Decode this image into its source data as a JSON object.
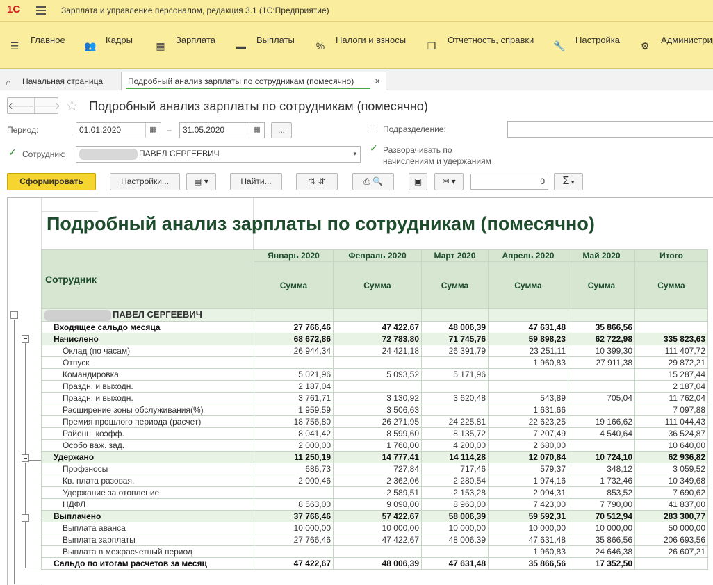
{
  "app": {
    "title": "Зарплата и управление персоналом, редакция 3.1  (1С:Предприятие)",
    "logo": "1С"
  },
  "sections": [
    {
      "label": "Главное",
      "icon": "menu-lines-icon"
    },
    {
      "label": "Кадры",
      "icon": "people-icon"
    },
    {
      "label": "Зарплата",
      "icon": "calculator-icon"
    },
    {
      "label": "Выплаты",
      "icon": "wallet-icon"
    },
    {
      "label": "Налоги и взносы",
      "icon": "percent-icon"
    },
    {
      "label": "Отчетность, справки",
      "icon": "documents-icon"
    },
    {
      "label": "Настройка",
      "icon": "wrench-icon"
    },
    {
      "label": "Администрир",
      "icon": "gear-icon"
    }
  ],
  "tabs": {
    "home": "Начальная страница",
    "active": "Подробный анализ зарплаты по сотрудникам (помесячно)"
  },
  "form": {
    "title": "Подробный анализ зарплаты по сотрудникам (помесячно)",
    "period_label": "Период:",
    "period_from": "01.01.2020",
    "period_dash": "–",
    "period_to": "31.05.2020",
    "dots": "...",
    "subdivision_label": "Подразделение:",
    "employee_label": "Сотрудник:",
    "employee_value": "ПАВЕЛ СЕРГЕЕВИЧ",
    "expand_label_1": "Разворачивать по",
    "expand_label_2": "начислениям и удержаниям",
    "btn_generate": "Сформировать",
    "btn_settings": "Настройки...",
    "btn_find": "Найти...",
    "sum_value": "0",
    "sum_icon": "Σ"
  },
  "report": {
    "title": "Подробный анализ зарплаты по сотрудникам (помесячно)",
    "employee_header": "Сотрудник",
    "months": [
      "Январь 2020",
      "Февраль 2020",
      "Март 2020",
      "Апрель 2020",
      "Май 2020",
      "Итого"
    ],
    "sum_label": "Сумма",
    "employee_name": "ПАВЕЛ СЕРГЕЕВИЧ",
    "rows": [
      {
        "label": "Входящее сальдо месяца",
        "vals": [
          "27 766,46",
          "47 422,67",
          "48 006,39",
          "47 631,48",
          "35 866,56",
          ""
        ]
      },
      {
        "label": "Начислено",
        "vals": [
          "68 672,86",
          "72 783,80",
          "71 745,76",
          "59 898,23",
          "62 722,98",
          "335 823,63"
        ]
      },
      {
        "label": "Оклад (по часам)",
        "vals": [
          "26 944,34",
          "24 421,18",
          "26 391,79",
          "23 251,11",
          "10 399,30",
          "111 407,72"
        ]
      },
      {
        "label": "Отпуск",
        "vals": [
          "",
          "",
          "",
          "1 960,83",
          "27 911,38",
          "29 872,21"
        ]
      },
      {
        "label": "Командировка",
        "vals": [
          "5 021,96",
          "5 093,52",
          "5 171,96",
          "",
          "",
          "15 287,44"
        ]
      },
      {
        "label": "Праздн. и выходн.",
        "vals": [
          "2 187,04",
          "",
          "",
          "",
          "",
          "2 187,04"
        ]
      },
      {
        "label": "Праздн. и выходн.",
        "vals": [
          "3 761,71",
          "3 130,92",
          "3 620,48",
          "543,89",
          "705,04",
          "11 762,04"
        ]
      },
      {
        "label": "Расширение зоны обслуживания(%)",
        "vals": [
          "1 959,59",
          "3 506,63",
          "",
          "1 631,66",
          "",
          "7 097,88"
        ]
      },
      {
        "label": "Премия прошлого периода (расчет)",
        "vals": [
          "18 756,80",
          "26 271,95",
          "24 225,81",
          "22 623,25",
          "19 166,62",
          "111 044,43"
        ]
      },
      {
        "label": "Районн. коэфф.",
        "vals": [
          "8 041,42",
          "8 599,60",
          "8 135,72",
          "7 207,49",
          "4 540,64",
          "36 524,87"
        ]
      },
      {
        "label": "Особо важ. зад.",
        "vals": [
          "2 000,00",
          "1 760,00",
          "4 200,00",
          "2 680,00",
          "",
          "10 640,00"
        ]
      },
      {
        "label": "Удержано",
        "vals": [
          "11 250,19",
          "14 777,41",
          "14 114,28",
          "12 070,84",
          "10 724,10",
          "62 936,82"
        ]
      },
      {
        "label": "Профзносы",
        "vals": [
          "686,73",
          "727,84",
          "717,46",
          "579,37",
          "348,12",
          "3 059,52"
        ]
      },
      {
        "label": "Кв. плата разовая.",
        "vals": [
          "2 000,46",
          "2 362,06",
          "2 280,54",
          "1 974,16",
          "1 732,46",
          "10 349,68"
        ]
      },
      {
        "label": "Удержание за отопление",
        "vals": [
          "",
          "2 589,51",
          "2 153,28",
          "2 094,31",
          "853,52",
          "7 690,62"
        ]
      },
      {
        "label": "НДФЛ",
        "vals": [
          "8 563,00",
          "9 098,00",
          "8 963,00",
          "7 423,00",
          "7 790,00",
          "41 837,00"
        ]
      },
      {
        "label": "Выплачено",
        "vals": [
          "37 766,46",
          "57 422,67",
          "58 006,39",
          "59 592,31",
          "70 512,94",
          "283 300,77"
        ]
      },
      {
        "label": "Выплата аванса",
        "vals": [
          "10 000,00",
          "10 000,00",
          "10 000,00",
          "10 000,00",
          "10 000,00",
          "50 000,00"
        ]
      },
      {
        "label": "Выплата зарплаты",
        "vals": [
          "27 766,46",
          "47 422,67",
          "48 006,39",
          "47 631,48",
          "35 866,56",
          "206 693,56"
        ]
      },
      {
        "label": "Выплата в межрасчетный период",
        "vals": [
          "",
          "",
          "",
          "1 960,83",
          "24 646,38",
          "26 607,21"
        ]
      },
      {
        "label": "Сальдо по итогам расчетов за месяц",
        "vals": [
          "47 422,67",
          "48 006,39",
          "47 631,48",
          "35 866,56",
          "17 352,50",
          ""
        ]
      }
    ]
  }
}
